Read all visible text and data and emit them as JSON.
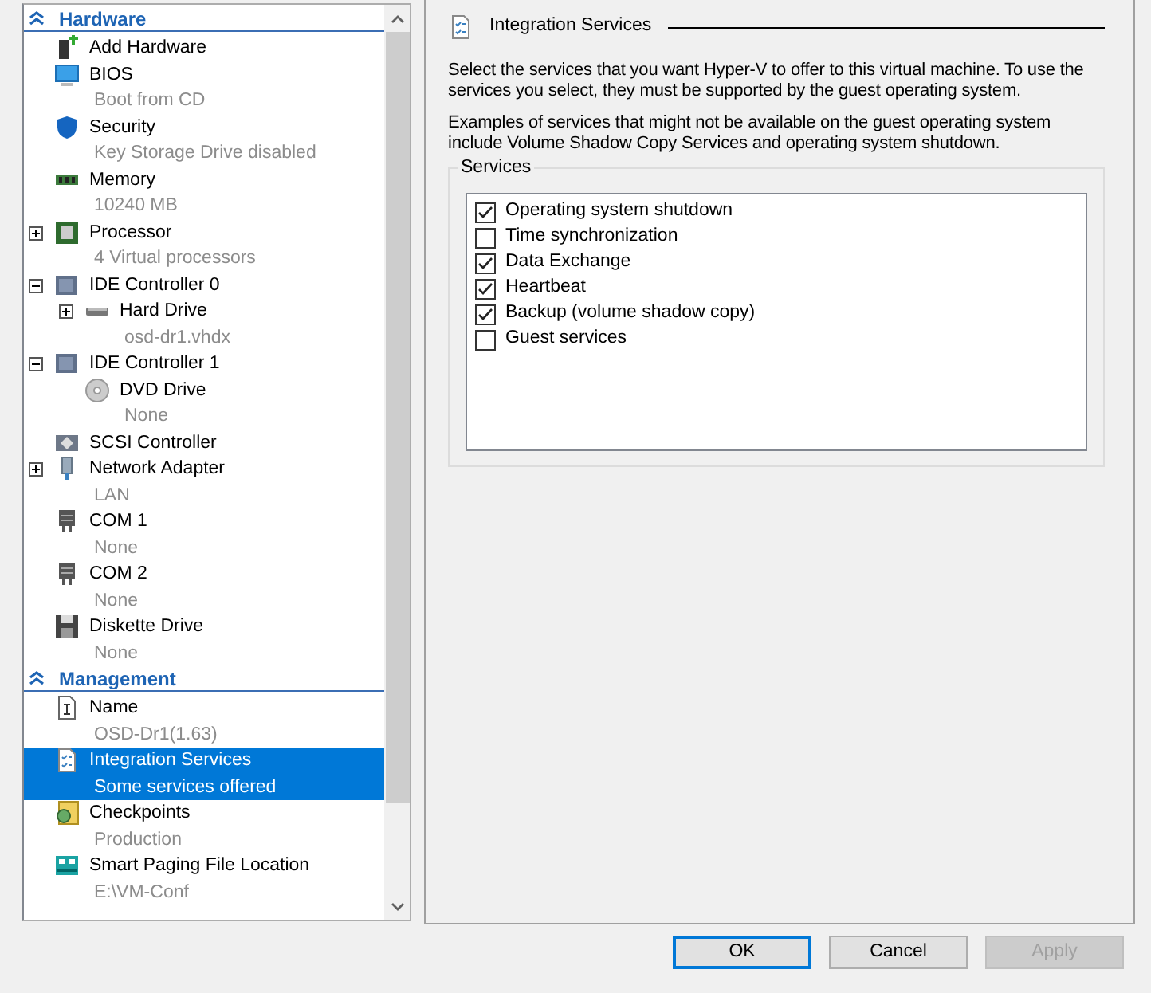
{
  "sidebar": {
    "sections": [
      {
        "title": "Hardware",
        "expanded": true,
        "items": [
          {
            "kind": "add-hardware",
            "label": "Add Hardware",
            "selected": false
          },
          {
            "kind": "bios",
            "label": "BIOS",
            "detail": "Boot from CD",
            "selected": false
          },
          {
            "kind": "security",
            "label": "Security",
            "detail": "Key Storage Drive disabled",
            "selected": false
          },
          {
            "kind": "memory",
            "label": "Memory",
            "detail": "10240 MB",
            "selected": false
          },
          {
            "kind": "processor",
            "label": "Processor",
            "detail": "4 Virtual processors",
            "expanded": false,
            "selected": false
          },
          {
            "kind": "controller",
            "label": "IDE Controller 0",
            "expanded": true,
            "selected": false,
            "children": [
              {
                "kind": "hard-drive",
                "label": "Hard Drive",
                "detail": "osd-dr1.vhdx",
                "expanded": false,
                "selected": false
              }
            ]
          },
          {
            "kind": "controller",
            "label": "IDE Controller 1",
            "expanded": true,
            "selected": false,
            "children": [
              {
                "kind": "dvd",
                "label": "DVD Drive",
                "detail": "None",
                "selected": false
              }
            ]
          },
          {
            "kind": "scsi",
            "label": "SCSI Controller",
            "selected": false
          },
          {
            "kind": "network",
            "label": "Network Adapter",
            "detail": "LAN",
            "expanded": false,
            "selected": false
          },
          {
            "kind": "com",
            "label": "COM 1",
            "detail": "None",
            "selected": false
          },
          {
            "kind": "com",
            "label": "COM 2",
            "detail": "None",
            "selected": false
          },
          {
            "kind": "diskette",
            "label": "Diskette Drive",
            "detail": "None",
            "selected": false
          }
        ]
      },
      {
        "title": "Management",
        "expanded": true,
        "items": [
          {
            "kind": "name",
            "label": "Name",
            "detail": "OSD-Dr1(1.63)",
            "selected": false
          },
          {
            "kind": "integration",
            "label": "Integration Services",
            "detail": "Some services offered",
            "selected": true
          },
          {
            "kind": "checkpoints",
            "label": "Checkpoints",
            "detail": "Production",
            "selected": false
          },
          {
            "kind": "paging",
            "label": "Smart Paging File Location",
            "detail": "E:\\VM-Conf",
            "selected": false
          }
        ]
      }
    ]
  },
  "panel": {
    "title": "Integration Services",
    "paragraphs": [
      "Select the services that you want Hyper-V to offer to this virtual machine. To use the services you select, they must be supported by the guest operating system.",
      "Examples of services that might not be available on the guest operating system include Volume Shadow Copy Services and operating system shutdown."
    ],
    "group_title": "Services",
    "services": [
      {
        "label": "Operating system shutdown",
        "checked": true
      },
      {
        "label": "Time synchronization",
        "checked": false
      },
      {
        "label": "Data Exchange",
        "checked": true
      },
      {
        "label": "Heartbeat",
        "checked": true
      },
      {
        "label": "Backup (volume shadow copy)",
        "checked": true
      },
      {
        "label": "Guest services",
        "checked": false
      }
    ]
  },
  "buttons": [
    {
      "label": "OK",
      "default": true,
      "disabled": false
    },
    {
      "label": "Cancel",
      "default": false,
      "disabled": false
    },
    {
      "label": "Apply",
      "default": false,
      "disabled": true
    }
  ]
}
